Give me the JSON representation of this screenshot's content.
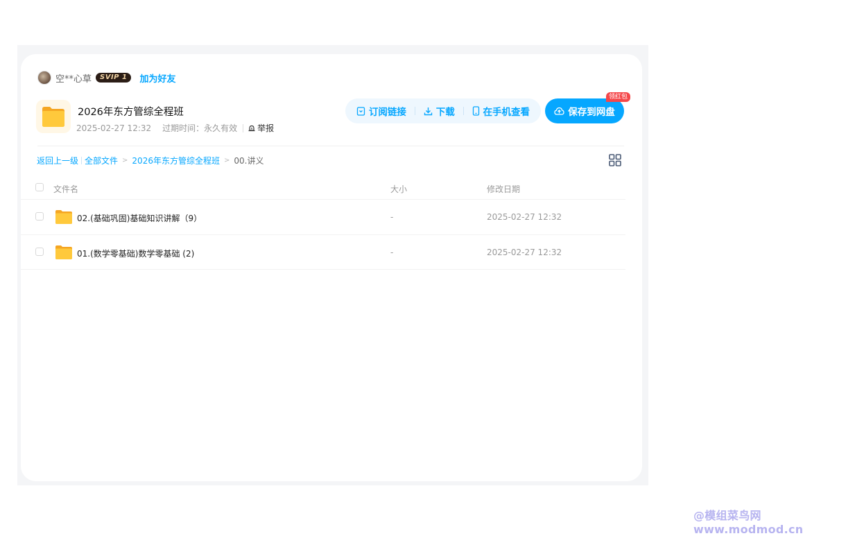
{
  "user": {
    "name": "空**心草",
    "vip_badge": "SVIP 1",
    "add_friend": "加为好友"
  },
  "share": {
    "title": "2026年东方管综全程班",
    "date": "2025-02-27 12:32",
    "expiry_label": "过期时间：",
    "expiry_value": "永久有效",
    "report": "举报"
  },
  "actions": {
    "subscribe": "订阅链接",
    "download": "下载",
    "view_on_phone": "在手机查看",
    "save": "保存到网盘",
    "red_packet_badge": "领红包"
  },
  "breadcrumb": {
    "back": "返回上一级",
    "all_files": "全部文件",
    "level1": "2026年东方管综全程班",
    "current": "00.讲义"
  },
  "table": {
    "headers": {
      "name": "文件名",
      "size": "大小",
      "modified": "修改日期"
    },
    "rows": [
      {
        "name": "02.(基础巩固)基础知识讲解（9）",
        "size": "-",
        "modified": "2025-02-27 12:32"
      },
      {
        "name": "01.(数学零基础)数学零基础 (2)",
        "size": "-",
        "modified": "2025-02-27 12:32"
      }
    ]
  },
  "watermark": "@模组菜鸟网www.modmod.cn",
  "colors": {
    "accent": "#06a7ff",
    "folder": "#ffc23a",
    "badge_red": "#f5474a"
  }
}
